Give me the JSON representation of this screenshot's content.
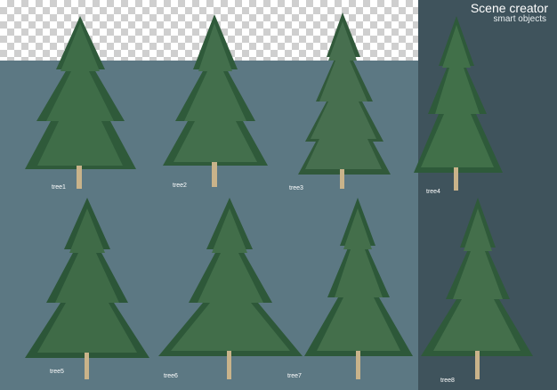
{
  "header": {
    "title": "Scene creator",
    "subtitle": "smart objects"
  },
  "trees": [
    {
      "label": "tree1"
    },
    {
      "label": "tree2"
    },
    {
      "label": "tree3"
    },
    {
      "label": "tree4"
    },
    {
      "label": "tree5"
    },
    {
      "label": "tree6"
    },
    {
      "label": "tree7"
    },
    {
      "label": "tree8"
    }
  ],
  "colors": {
    "background": "#5c7883",
    "right_panel": "#3f535c",
    "foliage_dark": "#2f5a3a",
    "foliage_light": "#4f7f56",
    "trunk": "#c9b38a",
    "label": "#ffffff"
  }
}
